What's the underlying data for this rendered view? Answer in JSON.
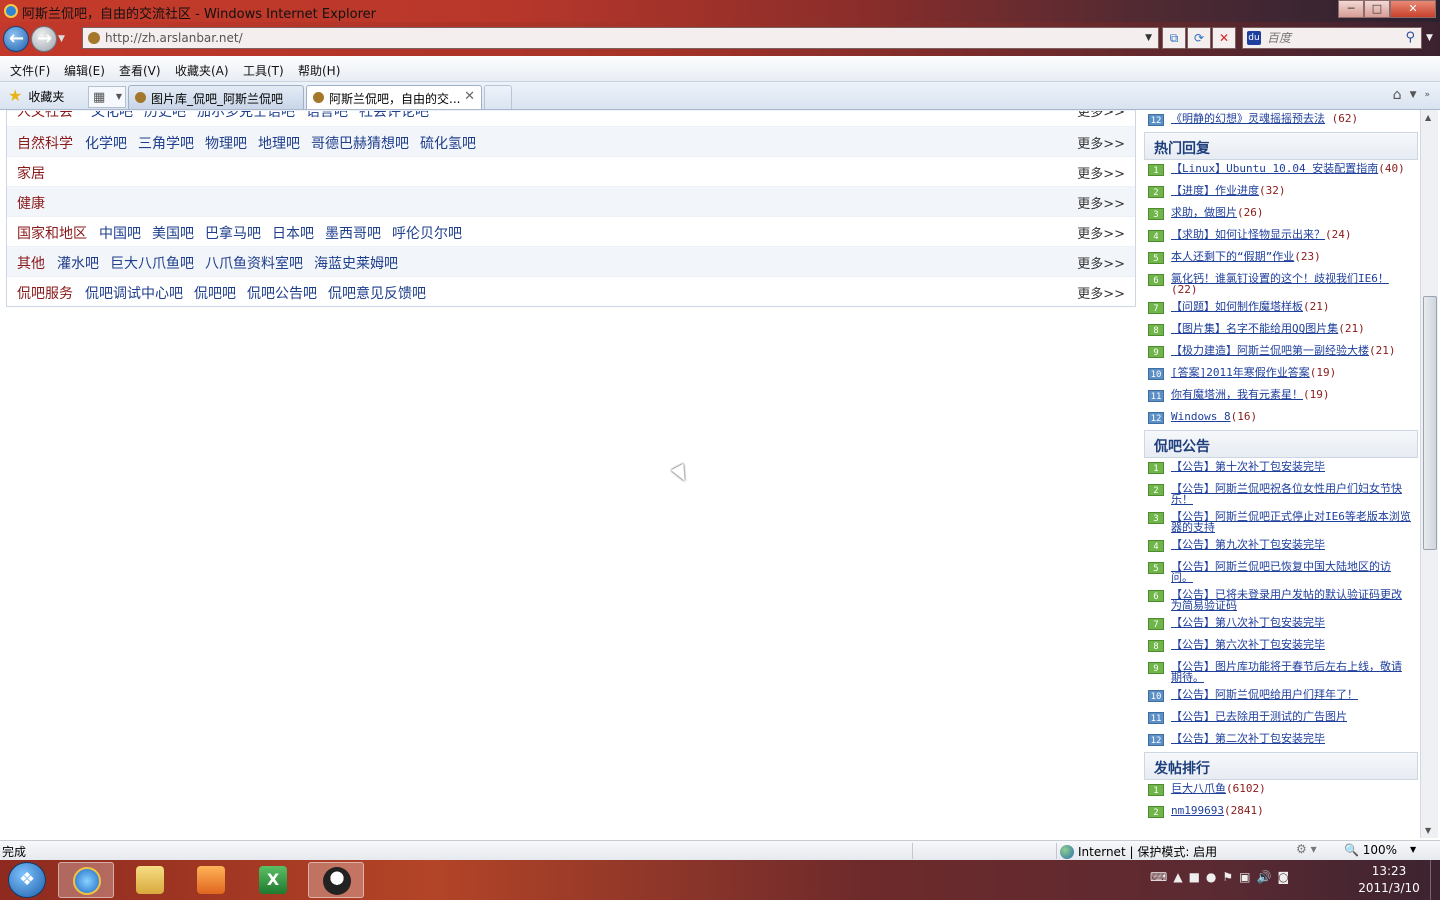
{
  "window": {
    "title": "阿斯兰侃吧，自由的交流社区 - Windows Internet Explorer",
    "min_label": "─",
    "max_label": "□",
    "close_label": "✕"
  },
  "address": {
    "url": "http://zh.arslanbar.net/",
    "search_placeholder": "百度"
  },
  "menu": [
    "文件(F)",
    "编辑(E)",
    "查看(V)",
    "收藏夹(A)",
    "工具(T)",
    "帮助(H)"
  ],
  "favorites_label": "收藏夹",
  "tabs": [
    {
      "title": "图片库_侃吧_阿斯兰侃吧"
    },
    {
      "title": "阿斯兰侃吧，自由的交..."
    }
  ],
  "categories": [
    {
      "name": "人文社会",
      "links": [
        "文化吧",
        "历史吧",
        "加尔多克士语吧",
        "语言吧",
        "社会评论吧"
      ],
      "more": "更多>>"
    },
    {
      "name": "自然科学",
      "links": [
        "化学吧",
        "三角学吧",
        "物理吧",
        "地理吧",
        "哥德巴赫猜想吧",
        "硫化氢吧"
      ],
      "more": "更多>>"
    },
    {
      "name": "家居",
      "links": [],
      "more": "更多>>"
    },
    {
      "name": "健康",
      "links": [],
      "more": "更多>>"
    },
    {
      "name": "国家和地区",
      "links": [
        "中国吧",
        "美国吧",
        "巴拿马吧",
        "日本吧",
        "墨西哥吧",
        "呼伦贝尔吧"
      ],
      "more": "更多>>"
    },
    {
      "name": "其他",
      "links": [
        "灌水吧",
        "巨大八爪鱼吧",
        "八爪鱼资料室吧",
        "海蓝史莱姆吧"
      ],
      "more": "更多>>"
    },
    {
      "name": "侃吧服务",
      "links": [
        "侃吧调试中心吧",
        "侃吧吧",
        "侃吧公告吧",
        "侃吧意见反馈吧"
      ],
      "more": "更多>>"
    }
  ],
  "sidebar": {
    "top_item": {
      "n": "12",
      "text": "《明静的幻想》灵魂摇摇预去法",
      "count": "(62)"
    },
    "hot_replies": {
      "title": "热门回复",
      "items": [
        {
          "n": "1",
          "text": "【Linux】Ubuntu 10.04 安装配置指南",
          "count": "(40)"
        },
        {
          "n": "2",
          "text": "【进度】作业进度",
          "count": "(32)"
        },
        {
          "n": "3",
          "text": "求助，做图片",
          "count": "(26)"
        },
        {
          "n": "4",
          "text": "【求助】如何让怪物显示出来？",
          "count": "(24)"
        },
        {
          "n": "5",
          "text": "本人还剩下的“假期”作业",
          "count": "(23)"
        },
        {
          "n": "6",
          "text": "氯化钙！谁氯钉设置的这个！歧视我们IE6！",
          "count": "(22)"
        },
        {
          "n": "7",
          "text": "【问题】如何制作魔塔样板",
          "count": "(21)"
        },
        {
          "n": "8",
          "text": "【图片集】名字不能给用QQ图片集",
          "count": "(21)"
        },
        {
          "n": "9",
          "text": "【极力建造】阿斯兰侃吧第一副经验大楼",
          "count": "(21)"
        },
        {
          "n": "10",
          "text": "[答案]2011年寒假作业答案",
          "count": "(19)"
        },
        {
          "n": "11",
          "text": "你有魔塔洲，我有元素星！",
          "count": "(19)"
        },
        {
          "n": "12",
          "text": "Windows 8",
          "count": "(16)"
        }
      ]
    },
    "announcements": {
      "title": "侃吧公告",
      "items": [
        {
          "n": "1",
          "text": "【公告】第十次补丁包安装完毕"
        },
        {
          "n": "2",
          "text": "【公告】阿斯兰侃吧祝各位女性用户们妇女节快乐！"
        },
        {
          "n": "3",
          "text": "【公告】阿斯兰侃吧正式停止对IE6等老版本浏览器的支持"
        },
        {
          "n": "4",
          "text": "【公告】第九次补丁包安装完毕"
        },
        {
          "n": "5",
          "text": "【公告】阿斯兰侃吧已恢复中国大陆地区的访问。"
        },
        {
          "n": "6",
          "text": "【公告】已将未登录用户发帖的默认验证码更改为简易验证码"
        },
        {
          "n": "7",
          "text": "【公告】第八次补丁包安装完毕"
        },
        {
          "n": "8",
          "text": "【公告】第六次补丁包安装完毕"
        },
        {
          "n": "9",
          "text": "【公告】图片库功能将于春节后左右上线，敬请期待。"
        },
        {
          "n": "10",
          "text": "【公告】阿斯兰侃吧给用户们拜年了！"
        },
        {
          "n": "11",
          "text": "【公告】已去除用于测试的广告图片"
        },
        {
          "n": "12",
          "text": "【公告】第二次补丁包安装完毕"
        }
      ]
    },
    "post_ranking": {
      "title": "发帖排行",
      "items": [
        {
          "n": "1",
          "text": "巨大八爪鱼",
          "count": "(6102)"
        },
        {
          "n": "2",
          "text": "nm199693",
          "count": "(2841)"
        }
      ]
    }
  },
  "status": {
    "text": "完成",
    "zone": "Internet | 保护模式: 启用",
    "zoom": "100%"
  },
  "taskbar": {
    "time": "13:23",
    "date": "2011/3/10"
  }
}
